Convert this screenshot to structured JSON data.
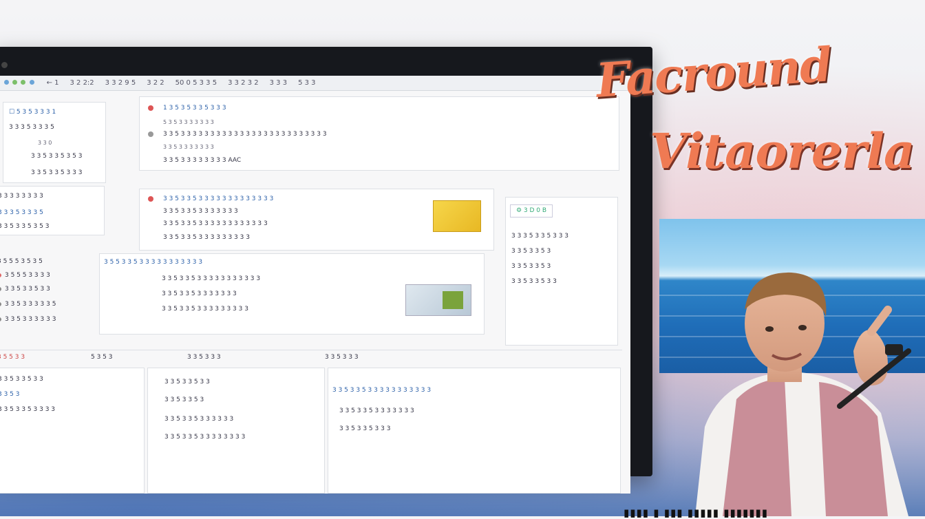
{
  "overlay_title": {
    "line1": "Facround",
    "line2": "Vitaorerla"
  },
  "toolbar": {
    "items": [
      "← 1",
      "3 2 2:2",
      "3 3 2 9 5",
      "3 2 2",
      "50 0 5 3 3 5",
      "3 3 2 3 2",
      "3 3 3",
      "5 3 3"
    ]
  },
  "left_panel": {
    "rows": [
      "☐ 5 3 5 3 3 3 1",
      "3 3 3 5 3 3 3 5",
      "3 3 0",
      "3 3 5 3 3 5 3 5 3",
      "3 3 3 3 3 3 3 3",
      "3 3 5 3 3 5 3 3 3"
    ]
  },
  "left_list": {
    "header": "3 5 5 5 3 5 3 5",
    "items": [
      "3 5 5 5 3 3 3 3",
      "3 3 5 3 3 5 3 3",
      "3 3 5 3 3 3 3 3 5",
      "3 3 5 3 3 3 3 3 3"
    ]
  },
  "email_top": {
    "subject": "1 3 5 3 5 3 3 5 3 3 3",
    "lines": [
      "5 3 5 3 3 3 3 3 3 3",
      "3 3 5 3 3 3 3 3 3 3 3 3 3 3 3 3 3 3 3 3 3 3 3 3 3 3 3 3",
      "3 3 5 3 3 3 3 3 3 3",
      "3 3 5 3 3 3 3 3 3 3 3 AAC"
    ]
  },
  "email_mid": {
    "lines": [
      "3 3 5 3 3 5 3 3 3 3 3 3 3 3 3 3 3 3 3",
      "3 3 5 3 3 5 3 3 3 3 3 3 3",
      "3 3 5 3 3 5 3 3 3 3 3 3 3 3 3 3 3 3",
      "3 3 5 3 3 5 3 3 3 3 3 3 3 3 3"
    ]
  },
  "email_low": {
    "header": "3 5 5 3 3 5 3 3 3 3 3 3 3 3 3 3 3",
    "lines": [
      "3 3 5 3 3 5 3 3 3 3 3 3 3 3 3 3 3",
      "3 3 5 3 3 5 3 3 3 3 3 3 3",
      "3 3 5 3 3 5 3 3 3 3 3 3 3 3 3"
    ]
  },
  "right_card": {
    "logo_text": "⚙ 3 D 0 B",
    "lines": [
      "3 3 3 5 3 3 5 3 3 3",
      "3 3 5 3 3 5 3",
      "3 3 5 3 3 5 3",
      "3 3 5 3 3 5 3 3"
    ]
  },
  "bottom_tabs": {
    "items": [
      "3 5 5 3 3",
      "5 3 5 3",
      "3 3 5 3 3 3",
      "3 3 5 3 3 3"
    ]
  },
  "bottom_panels": {
    "left_lines": [
      "3 3 5 3 3 5 3 3",
      "3 3 5 3",
      "3 3 5 3 3 5 3 3 3 3"
    ],
    "mid_lines": [
      "3 3 5 3 3 5 3 3",
      "3 3 5 3 3 5 3",
      "3 3 5 3 3 5 3 3 3 3 3 3",
      "3 3 5 3 3 5 3 3 3 3 3 3 3 3"
    ],
    "right_lines": [
      "3 3 5 3 3 5 3 3 3 3 3 3 3 3 3 3 3",
      "3 3 5 3 3 5 3 3 3 3 3 3 3",
      "3 3 5 3 3 5 3 3 3"
    ]
  },
  "colors": {
    "accent_orange": "#ef7a53",
    "ocean": "#1f6db8"
  }
}
